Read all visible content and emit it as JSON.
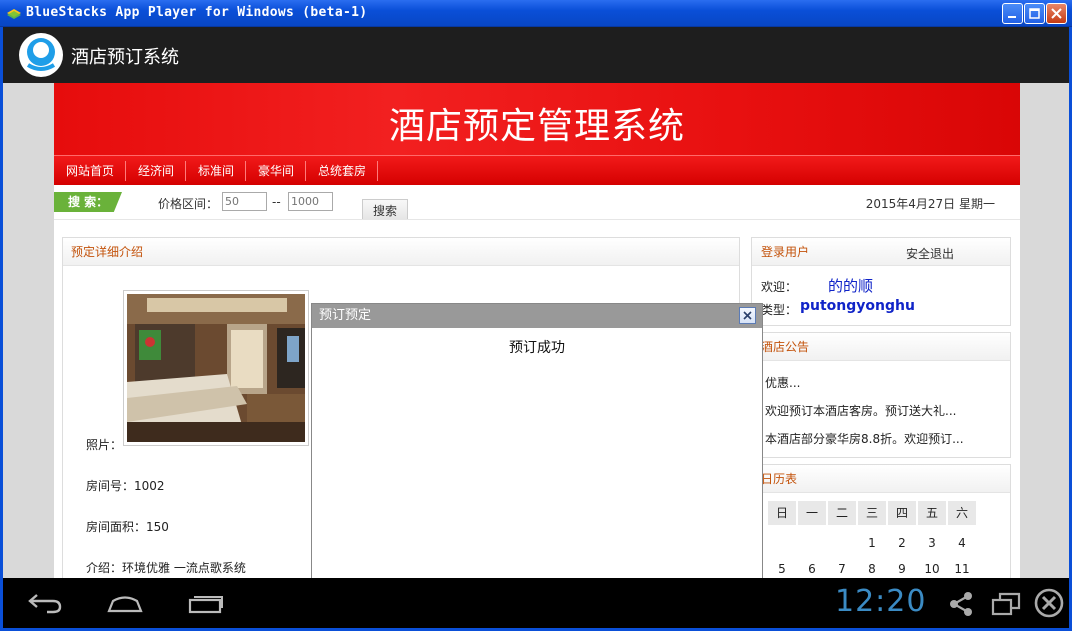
{
  "window": {
    "title": "BlueStacks App Player for Windows (beta-1)"
  },
  "app": {
    "title": "酒店预订系统"
  },
  "site": {
    "banner_title": "酒店预定管理系统",
    "nav": [
      "网站首页",
      "经济间",
      "标准间",
      "豪华间",
      "总统套房"
    ],
    "search": {
      "tag": "搜 索：",
      "price_label": "价格区间：",
      "min_placeholder": "50",
      "dash": "--",
      "max_placeholder": "1000",
      "button": "搜索"
    },
    "date": "2015年4月27日 星期一"
  },
  "detail": {
    "heading": "预定详细介绍",
    "photo_label": "照片：",
    "room_no": "房间号：1002",
    "area": "房间面积：150",
    "intro": "介绍：环境优雅 一流点歌系统"
  },
  "user_panel": {
    "heading": "登录用户",
    "logout": "安全退出",
    "welcome_label": "欢迎：",
    "welcome_name": "的的顺",
    "type_label": "类型：",
    "type_value": "putongyonghu"
  },
  "notice_panel": {
    "heading": "酒店公告",
    "items": [
      "优惠...",
      "欢迎预订本酒店客房。预订送大礼...",
      "本酒店部分豪华房8.8折。欢迎预订..."
    ]
  },
  "calendar_panel": {
    "heading": "日历表",
    "weekdays": [
      "日",
      "一",
      "二",
      "三",
      "四",
      "五",
      "六"
    ],
    "row1": [
      "",
      "",
      "",
      "1",
      "2",
      "3",
      "4"
    ],
    "row2": [
      "5",
      "6",
      "7",
      "8",
      "9",
      "10",
      "11"
    ]
  },
  "dialog": {
    "title": "预订预定",
    "message": "预订成功"
  },
  "android_nav": {
    "clock": "12:20"
  },
  "colors": {
    "banner_red": "#e60c0c",
    "accent_orange": "#c3520a",
    "search_green": "#6ab23a",
    "clock_blue": "#3b8bc4"
  }
}
